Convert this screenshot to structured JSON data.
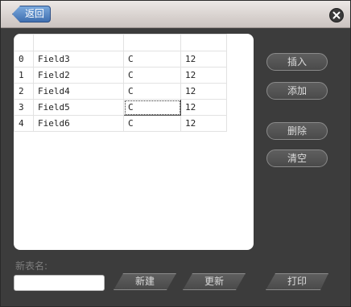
{
  "titlebar": {
    "back_label": "返回",
    "close_icon": "close-icon"
  },
  "table": {
    "header": [
      "",
      "",
      "",
      ""
    ],
    "rows": [
      [
        "0",
        "Field3",
        "C",
        "12"
      ],
      [
        "1",
        "Field2",
        "C",
        "12"
      ],
      [
        "2",
        "Field4",
        "C",
        "12"
      ],
      [
        "3",
        "Field5",
        "C",
        "12"
      ],
      [
        "4",
        "Field6",
        "C",
        "12"
      ]
    ],
    "selected_cell": {
      "row": 3,
      "col": 2
    }
  },
  "side_buttons": {
    "insert": "插入",
    "add": "添加",
    "delete": "删除",
    "clear": "清空"
  },
  "form": {
    "new_name_label": "新表名:",
    "new_name_value": ""
  },
  "bottom_buttons": {
    "create": "新建",
    "update": "更新",
    "print": "打印"
  },
  "colors": {
    "window_bg": "#3c3c3c",
    "accent_blue": "#3f6fb0",
    "button_bg": "#555555"
  }
}
